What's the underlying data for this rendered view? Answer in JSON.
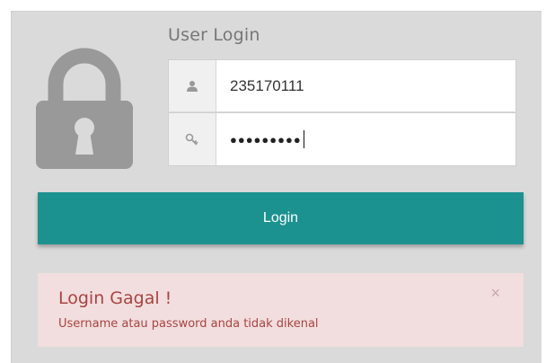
{
  "login_form": {
    "title": "User Login",
    "username": {
      "icon": "user-icon",
      "value": "235170111"
    },
    "password": {
      "icon": "key-icon",
      "masked_value": "●●●●●●●●●"
    },
    "login_button_label": "Login"
  },
  "alert": {
    "title": "Login Gagal !",
    "message": "Username atau password anda tidak dikenal",
    "close_symbol": "×"
  },
  "colors": {
    "panel_background": "#dadada",
    "button": "#1b9290",
    "alert_background": "#f2dede",
    "alert_text": "#a94442",
    "lock_icon": "#999999"
  }
}
